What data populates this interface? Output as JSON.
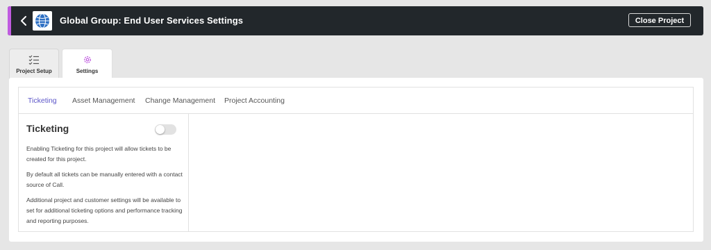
{
  "header": {
    "title": "Global Group: End User Services Settings",
    "close_label": "Close Project",
    "accent_color": "#c05be0",
    "background_color": "#22272b",
    "back_icon": "chevron-left-icon",
    "logo_icon": "globe-logo"
  },
  "top_tabs": [
    {
      "label": "Project Setup",
      "icon": "checklist-icon",
      "active": false
    },
    {
      "label": "Settings",
      "icon": "gear-icon",
      "active": true
    }
  ],
  "sub_tabs": [
    {
      "label": "Ticketing",
      "active": true
    },
    {
      "label": "Asset Management",
      "active": false
    },
    {
      "label": "Change Management",
      "active": false
    },
    {
      "label": "Project Accounting",
      "active": false
    }
  ],
  "ticketing": {
    "title": "Ticketing",
    "enabled": false,
    "paragraphs": [
      "Enabling Ticketing for this project will allow tickets to be created for this project.",
      "By default all tickets can be manually entered with a contact source of Call.",
      "Additional project and customer settings will be available to set for additional ticketing options and performance tracking and reporting purposes."
    ]
  },
  "colors": {
    "active_tab_text": "#5b55c8",
    "settings_icon": "#c05be0"
  }
}
